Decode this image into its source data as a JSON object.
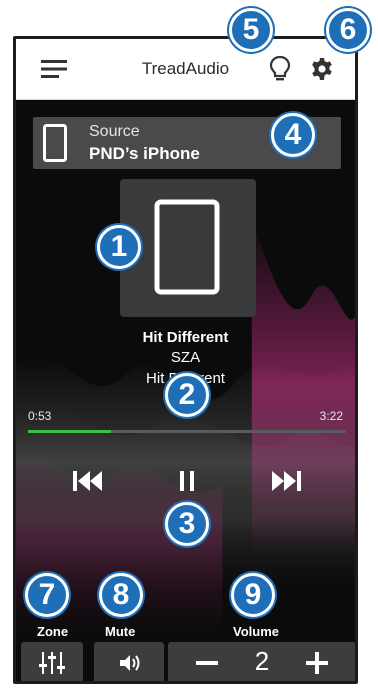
{
  "header": {
    "title": "TreadAudio",
    "menu_icon": "menu-icon",
    "bulb_icon": "lightbulb-icon",
    "settings_icon": "gear-icon"
  },
  "source": {
    "label": "Source",
    "name": "PND’s iPhone",
    "icon": "phone-icon"
  },
  "now_playing": {
    "title": "Hit Different",
    "artist": "SZA",
    "album": "Hit Different",
    "album_icon": "phone-icon"
  },
  "progress": {
    "elapsed": "0:53",
    "total": "3:22",
    "fraction": 0.26,
    "color": "#35c24a"
  },
  "controls": {
    "prev_icon": "skip-previous-icon",
    "pause_icon": "pause-icon",
    "next_icon": "skip-next-icon"
  },
  "bottom": {
    "zone_label": "Zone",
    "zone_icon": "equalizer-sliders-icon",
    "mute_label": "Mute",
    "mute_icon": "speaker-icon",
    "volume_label": "Volume",
    "volume_value": "2",
    "minus": "−",
    "plus": "+"
  },
  "callouts": [
    "1",
    "2",
    "3",
    "4",
    "5",
    "6",
    "7",
    "8",
    "9"
  ],
  "colors": {
    "callout": "#1e6fb8",
    "panel": "#3d3d3f",
    "source_bg": "#4a4a4c"
  }
}
